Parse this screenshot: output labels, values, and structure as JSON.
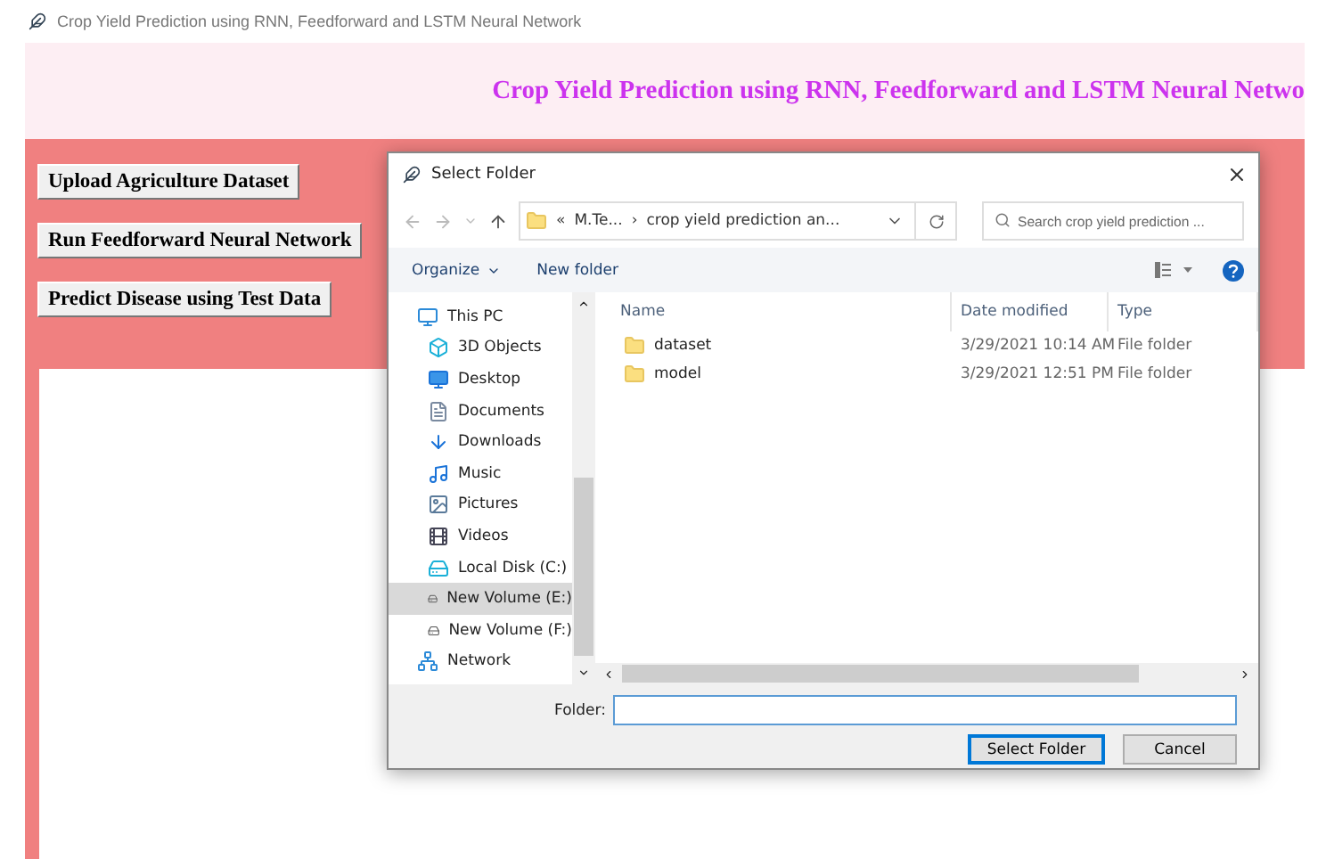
{
  "window": {
    "title": "Crop Yield Prediction using RNN, Feedforward and LSTM Neural Network"
  },
  "header": {
    "title": "Crop Yield Prediction using RNN, Feedforward and LSTM Neural Netwo"
  },
  "buttons": [
    "Upload Agriculture Dataset",
    "Run Feedforward Neural Network",
    "Predict Disease using Test Data"
  ],
  "dialog": {
    "title": "Select Folder",
    "address": {
      "parts": [
        "«",
        "M.Te...",
        "›",
        "crop yield prediction an..."
      ]
    },
    "search": {
      "placeholder": "Search crop yield prediction ..."
    },
    "toolbar": {
      "organize": "Organize",
      "new_folder": "New folder"
    },
    "nav": [
      {
        "label": "This PC",
        "kind": "pc",
        "selected": false,
        "children": [
          {
            "label": "3D Objects",
            "kind": "cube",
            "selected": false
          },
          {
            "label": "Desktop",
            "kind": "desktop",
            "selected": false
          },
          {
            "label": "Documents",
            "kind": "documents",
            "selected": false
          },
          {
            "label": "Downloads",
            "kind": "downloads",
            "selected": false
          },
          {
            "label": "Music",
            "kind": "music",
            "selected": false
          },
          {
            "label": "Pictures",
            "kind": "pictures",
            "selected": false
          },
          {
            "label": "Videos",
            "kind": "videos",
            "selected": false
          },
          {
            "label": "Local Disk (C:)",
            "kind": "system-drive",
            "selected": false
          },
          {
            "label": "New Volume (E:)",
            "kind": "drive",
            "selected": true
          },
          {
            "label": "New Volume (F:)",
            "kind": "drive",
            "selected": false
          }
        ]
      },
      {
        "label": "Network",
        "kind": "network",
        "selected": false
      }
    ],
    "columns": [
      "Name",
      "Date modified",
      "Type"
    ],
    "files": [
      {
        "name": "dataset",
        "date": "3/29/2021 10:14 AM",
        "type": "File folder"
      },
      {
        "name": "model",
        "date": "3/29/2021 12:51 PM",
        "type": "File folder"
      }
    ],
    "folder_label": "Folder:",
    "actions": [
      {
        "label": "Select Folder",
        "default": true
      },
      {
        "label": "Cancel",
        "default": false
      }
    ]
  }
}
